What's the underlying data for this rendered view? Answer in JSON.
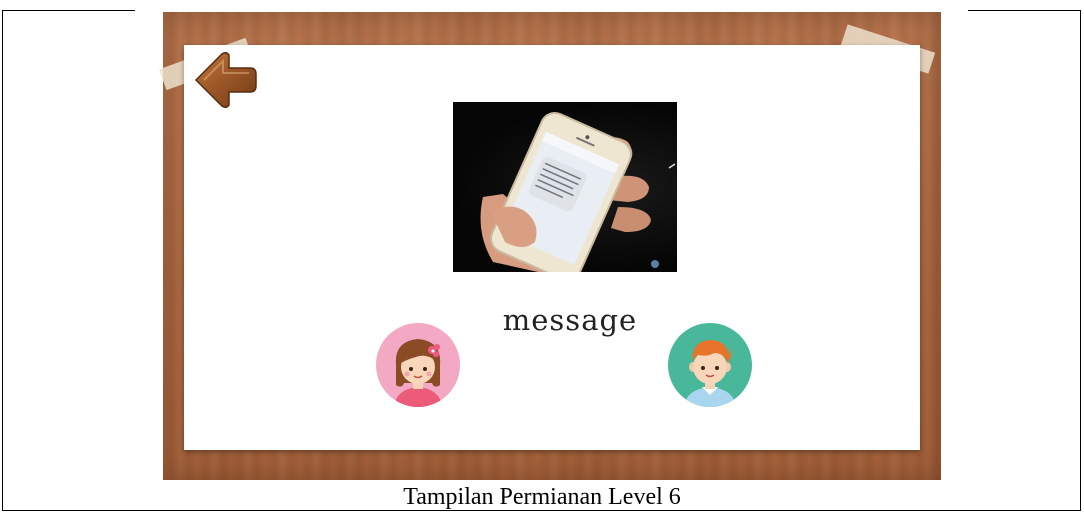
{
  "game": {
    "word": "message",
    "level_caption": "Tampilan Permianan Level 6"
  },
  "controls": {
    "back_icon": "arrow-left-icon"
  },
  "options": {
    "girl_icon": "girl-avatar-icon",
    "boy_icon": "boy-avatar-icon"
  },
  "colors": {
    "wood": "#b06b43",
    "girl_circle": "#f3a8c4",
    "boy_circle": "#49b89a",
    "arrow": "#8a4a1f"
  }
}
